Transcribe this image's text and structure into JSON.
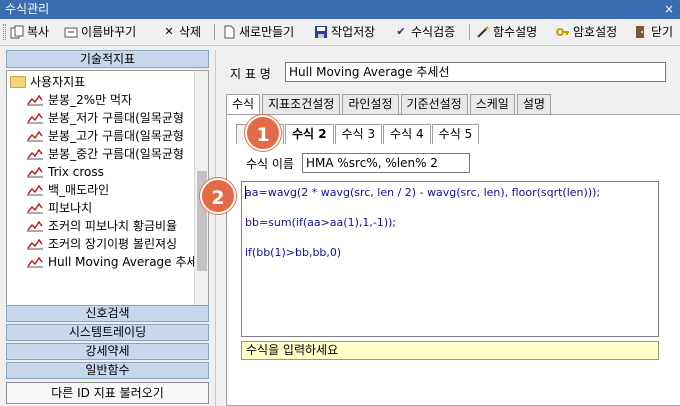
{
  "window": {
    "title": "수식관리",
    "close_glyph": "×"
  },
  "toolbar": {
    "copy": "복사",
    "rename": "이름바꾸기",
    "delete": "삭제",
    "new": "새로만들기",
    "save": "작업저장",
    "verify": "수식검증",
    "func_help": "함수설명",
    "encrypt": "암호설정",
    "close": "닫기"
  },
  "left": {
    "header": "기술적지표",
    "folder": "사용자지표",
    "items": [
      "분봉_2%만 먹자",
      "분봉_저가 구름대(일목균형",
      "분봉_고가 구름대(일목균형",
      "분봉_중간 구름대(일목균형",
      "Trix cross",
      "백_매도라인",
      "피보나치",
      "조커의 피보나치 황금비율",
      "조커의 장기이평 볼린져싱",
      "Hull Moving Average 추세"
    ],
    "categories": [
      "신호검색",
      "시스템트레이딩",
      "강세약세",
      "일반함수"
    ],
    "load_other": "다른 ID 지표 불러오기"
  },
  "right": {
    "name_label": "지 표 명",
    "name_value": "Hull Moving Average 추세선",
    "tabs": [
      "수식",
      "지표조건설정",
      "라인설정",
      "기준선설정",
      "스케일",
      "설명"
    ],
    "subtabs": [
      "수식 2",
      "수식 3",
      "수식 4",
      "수식 5"
    ],
    "formula_name_label": "수식 이름",
    "formula_name_value": "HMA %src%, %len% 2",
    "code": [
      "aa=wavg(2 * wavg(src, len / 2) - wavg(src, len), floor(sqrt(len)));",
      "bb=sum(if(aa>aa(1),1,-1));",
      "if(bb(1)>bb,bb,0)"
    ],
    "hint": "수식을 입력하세요"
  },
  "badges": [
    "1",
    "2"
  ],
  "colors": {
    "titlebar": "#3c6cb0",
    "badge": "#e36a47",
    "code": "#1010a0",
    "hint_bg": "#ffffc8"
  }
}
